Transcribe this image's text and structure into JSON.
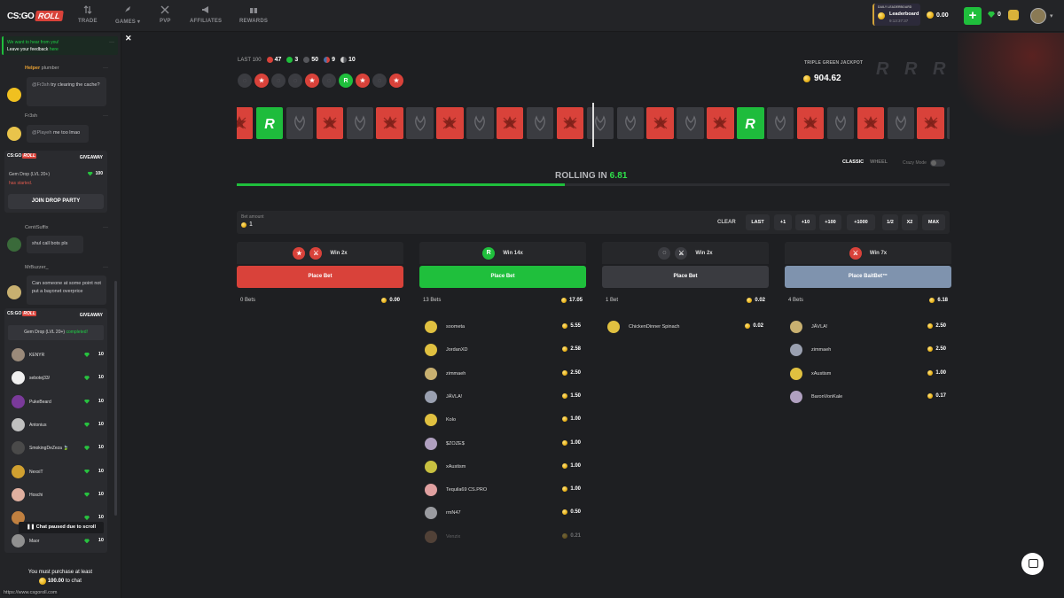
{
  "nav": {
    "trade": "TRADE",
    "games": "GAMES",
    "pvp": "PVP",
    "affiliates": "AFFILIATES",
    "rewards": "REWARDS"
  },
  "logo": {
    "cs": "CS:GO",
    "roll": "ROLL"
  },
  "leaderboard": {
    "small": "DAILY LEADERBOARD",
    "title": "Leaderboard",
    "timer": "9:13:37:37"
  },
  "balance": {
    "coins": "0.00",
    "gems": "0"
  },
  "chat": {
    "feedback": {
      "line1": "We want to hear from you!",
      "line2": "Leave your feedback ",
      "link": "here"
    },
    "messages": [
      {
        "tag": "Helper",
        "name": "plumber"
      },
      {
        "name": "Fr3sh",
        "text": "try clearing the cache?",
        "mention": "@Fr3sh"
      },
      {
        "name": "Fr3sh",
        "text": "me too lmao",
        "mention": "@Playeh"
      },
      {
        "name": "CentiSuffix",
        "text": "shul call bots pls"
      },
      {
        "name": "MrBuzzer_",
        "text": "Can someone at some point not put a bayonet overprice"
      }
    ],
    "giveaway1": {
      "title": "GIVEAWAY",
      "name": "Gem Drop (LVL 20+)",
      "value": "100",
      "status": "has started.",
      "button": "JOIN DROP PARTY"
    },
    "giveaway2": {
      "title": "GIVEAWAY",
      "name": "Gem Drop (LVL 20+)",
      "completed": "completed!"
    },
    "winners": [
      {
        "name": "KENYR",
        "value": "10"
      },
      {
        "name": "sebotej33/",
        "value": "10"
      },
      {
        "name": "PukeBeard",
        "value": "10"
      },
      {
        "name": "Antonius",
        "value": "10"
      },
      {
        "name": "SmokingDeZeza 🍃",
        "value": "10"
      },
      {
        "name": "NexxiT",
        "value": "10"
      },
      {
        "name": "Hoschi",
        "value": "10"
      },
      {
        "name": "",
        "value": "10"
      },
      {
        "name": "Maor",
        "value": "10"
      }
    ],
    "paused": "Chat paused due to scroll",
    "purchase_line1": "You must purchase at least",
    "purchase_amount": "100.00",
    "purchase_line2": "to chat",
    "status_url": "https://www.csgoroll.com"
  },
  "game": {
    "last100_label": "LAST 100",
    "counts": {
      "red": "47",
      "green": "3",
      "bait": "50",
      "blue_red": "9",
      "half": "10"
    },
    "history": [
      "b",
      "r",
      "b",
      "b",
      "r",
      "b",
      "g",
      "r",
      "b",
      "r"
    ],
    "jackpot_label": "TRIPLE GREEN JACKPOT",
    "jackpot_value": "904.62",
    "reel": [
      "r",
      "g",
      "b",
      "r",
      "b",
      "r",
      "b",
      "r",
      "b",
      "r",
      "b",
      "r",
      "b",
      "b",
      "r",
      "b",
      "r",
      "g",
      "b",
      "r",
      "b",
      "r",
      "b",
      "r",
      "b",
      "r",
      "b",
      "r"
    ],
    "mode_classic": "CLASSIC",
    "mode_wheel": "WHEEL",
    "crazy_mode": "Crazy Mode",
    "rolling_label": "ROLLING IN",
    "rolling_value": "6.81",
    "rolling_progress": 0.46
  },
  "bet": {
    "label": "Bet amount",
    "value": "1",
    "clear": "CLEAR",
    "buttons": [
      "LAST",
      "+1",
      "+10",
      "+100",
      "+1000",
      "1/2",
      "X2",
      "MAX"
    ]
  },
  "columns": [
    {
      "win": "Win 2x",
      "button": "Place Bet",
      "bets_count": "0 Bets",
      "total": "0.00",
      "button_color": "#d9423a",
      "players": []
    },
    {
      "win": "Win 14x",
      "button": "Place Bet",
      "bets_count": "13 Bets",
      "total": "17.05",
      "button_color": "#1fbf3c",
      "players": [
        {
          "name": "soometa",
          "amount": "5.55"
        },
        {
          "name": "JordanXD",
          "amount": "2.58"
        },
        {
          "name": "zimmaeh",
          "amount": "2.50"
        },
        {
          "name": "JÄVLA!",
          "amount": "1.50"
        },
        {
          "name": "Kolo",
          "amount": "1.00"
        },
        {
          "name": "$ZOZE$",
          "amount": "1.00"
        },
        {
          "name": "xAustism",
          "amount": "1.00"
        },
        {
          "name": "Tequila69 CS.PRO",
          "amount": "1.00"
        },
        {
          "name": "rmN47",
          "amount": "0.50"
        },
        {
          "name": "Venzix",
          "amount": "0.21"
        }
      ]
    },
    {
      "win": "Win 2x",
      "button": "Place Bet",
      "bets_count": "1 Bet",
      "total": "0.02",
      "button_color": "#3a3b40",
      "players": [
        {
          "name": "ChickenDinner Spinach",
          "amount": "0.02"
        }
      ]
    },
    {
      "win": "Win 7x",
      "button": "Place BaitBet™",
      "bets_count": "4 Bets",
      "total": "6.18",
      "button_color": "#7f93ae",
      "players": [
        {
          "name": "JÄVLA!",
          "amount": "2.50"
        },
        {
          "name": "zimmaeh",
          "amount": "2.50"
        },
        {
          "name": "xAustism",
          "amount": "1.00"
        },
        {
          "name": "BaronVonKale",
          "amount": "0.17"
        }
      ]
    }
  ]
}
